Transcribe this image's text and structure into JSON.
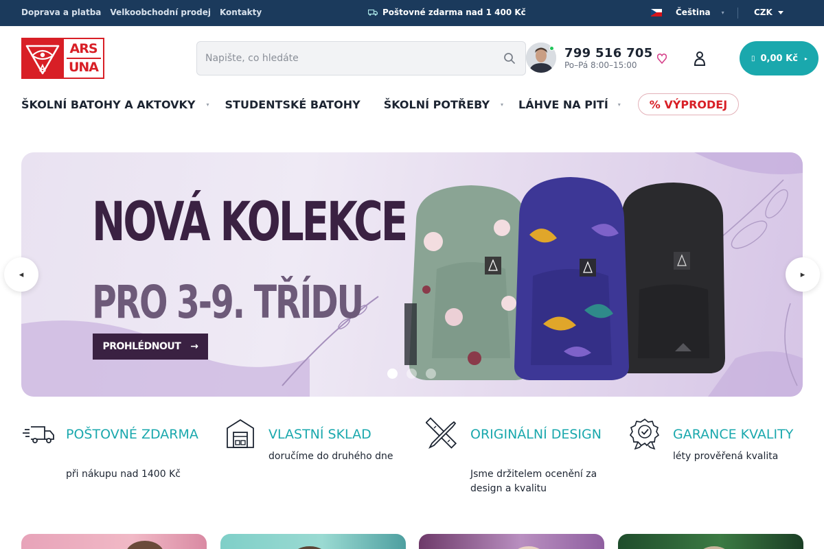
{
  "topbar": {
    "links": [
      "Doprava a platba",
      "Velkoobchodní prodej",
      "Kontakty"
    ],
    "promo": "Poštovné zdarma nad 1 400 Kč",
    "language": "Čeština",
    "currency": "CZK"
  },
  "header": {
    "logo": [
      "ARS",
      "UNA"
    ],
    "search_placeholder": "Napište, co hledáte",
    "phone": "799 516 705",
    "hours": "Po–Pá 8:00–15:00",
    "cart_total": "0,00 Kč"
  },
  "nav": {
    "items": [
      "ŠKOLNÍ BATOHY A AKTOVKY",
      "STUDENTSKÉ BATOHY",
      "ŠKOLNÍ POTŘEBY",
      "LÁHVE NA PITÍ"
    ],
    "sale": "% VÝPRODEJ"
  },
  "hero": {
    "title": "NOVÁ KOLEKCE",
    "subtitle": "PRO 3-9. TŘÍDU",
    "cta": "PROHLÉDNOUT",
    "slides": 3,
    "active_slide": 1
  },
  "features": [
    {
      "title": "POŠTOVNÉ ZDARMA",
      "desc": "při nákupu nad 1400 Kč",
      "icon": "truck-icon"
    },
    {
      "title": "VLASTNÍ SKLAD",
      "desc": "doručíme do druhého dne",
      "icon": "warehouse-icon"
    },
    {
      "title": "ORIGINÁLNÍ DESIGN",
      "desc": "Jsme držitelem ocenění za design a kvalitu",
      "icon": "design-tools-icon"
    },
    {
      "title": "GARANCE KVALITY",
      "desc": "léty prověřená kvalita",
      "icon": "quality-badge-icon"
    }
  ],
  "colors": {
    "topbar": "#1b3a5c",
    "brand_red": "#d81f26",
    "accent_teal": "#1aa8ad",
    "hero_dark": "#3a2142"
  }
}
